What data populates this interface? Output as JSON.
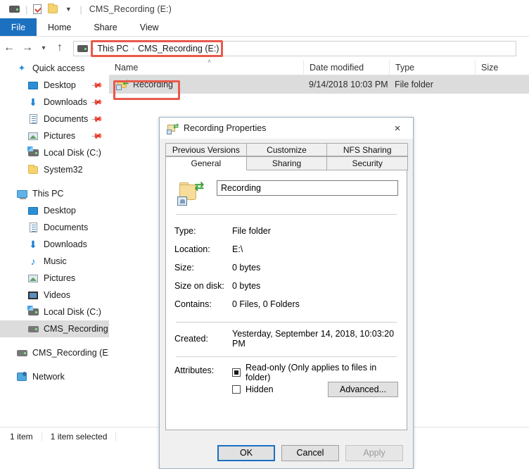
{
  "window": {
    "title": "CMS_Recording (E:)",
    "quick_access_icons": [
      "drive-icon",
      "properties-icon",
      "new-folder-icon",
      "customize-chevron-icon"
    ]
  },
  "ribbon": {
    "tabs": [
      {
        "label": "File",
        "active": true
      },
      {
        "label": "Home",
        "active": false
      },
      {
        "label": "Share",
        "active": false
      },
      {
        "label": "View",
        "active": false
      }
    ]
  },
  "addressbar": {
    "back_icon": "back-arrow-icon",
    "forward_icon": "forward-arrow-icon",
    "recent_icon": "recent-locations-chevron-icon",
    "up_icon": "up-arrow-icon",
    "drive_icon": "drive-icon",
    "crumbs": [
      "This PC",
      "CMS_Recording (E:)"
    ],
    "separator": "›"
  },
  "sidebar": {
    "groups": [
      {
        "header": {
          "label": "Quick access",
          "icon": "star-icon"
        },
        "items": [
          {
            "label": "Desktop",
            "icon": "monitor-icon",
            "pinned": true,
            "selected": false
          },
          {
            "label": "Downloads",
            "icon": "download-icon",
            "pinned": true,
            "selected": false
          },
          {
            "label": "Documents",
            "icon": "document-icon",
            "pinned": true,
            "selected": false
          },
          {
            "label": "Pictures",
            "icon": "picture-icon",
            "pinned": true,
            "selected": false
          },
          {
            "label": "Local Disk (C:)",
            "icon": "system-disk-icon",
            "pinned": false,
            "selected": false
          },
          {
            "label": "System32",
            "icon": "folder-icon",
            "pinned": false,
            "selected": false
          }
        ]
      },
      {
        "header": {
          "label": "This PC",
          "icon": "this-pc-icon"
        },
        "items": [
          {
            "label": "Desktop",
            "icon": "monitor-icon",
            "pinned": false,
            "selected": false
          },
          {
            "label": "Documents",
            "icon": "document-icon",
            "pinned": false,
            "selected": false
          },
          {
            "label": "Downloads",
            "icon": "download-icon",
            "pinned": false,
            "selected": false
          },
          {
            "label": "Music",
            "icon": "music-icon",
            "pinned": false,
            "selected": false
          },
          {
            "label": "Pictures",
            "icon": "picture-icon",
            "pinned": false,
            "selected": false
          },
          {
            "label": "Videos",
            "icon": "video-icon",
            "pinned": false,
            "selected": false
          },
          {
            "label": "Local Disk (C:)",
            "icon": "system-disk-icon",
            "pinned": false,
            "selected": false
          },
          {
            "label": "CMS_Recording (E:)",
            "icon": "drive-icon",
            "pinned": false,
            "selected": true
          }
        ]
      },
      {
        "header": {
          "label": "CMS_Recording (E:)",
          "icon": "drive-icon"
        },
        "items": []
      },
      {
        "header": {
          "label": "Network",
          "icon": "network-icon"
        },
        "items": []
      }
    ]
  },
  "filelist": {
    "columns": [
      "Name",
      "Date modified",
      "Type",
      "Size"
    ],
    "sort_column": "Name",
    "sort_caret": "˄",
    "rows": [
      {
        "name": "Recording",
        "icon": "shared-folder-icon",
        "date_modified": "9/14/2018 10:03 PM",
        "type": "File folder",
        "size": "",
        "selected": true
      }
    ]
  },
  "statusbar": {
    "item_count": "1 item",
    "selection": "1 item selected"
  },
  "dialog": {
    "title": "Recording Properties",
    "title_icon": "shared-folder-icon",
    "close_icon": "×",
    "tabs_row1": [
      {
        "label": "Previous Versions",
        "active": false
      },
      {
        "label": "Customize",
        "active": false
      },
      {
        "label": "NFS Sharing",
        "active": false
      }
    ],
    "tabs_row2": [
      {
        "label": "General",
        "active": true
      },
      {
        "label": "Sharing",
        "active": false
      },
      {
        "label": "Security",
        "active": false
      }
    ],
    "folder_icon": "shared-folder-large-icon",
    "name_value": "Recording",
    "properties": [
      {
        "label": "Type:",
        "value": "File folder"
      },
      {
        "label": "Location:",
        "value": "E:\\"
      },
      {
        "label": "Size:",
        "value": "0 bytes"
      },
      {
        "label": "Size on disk:",
        "value": "0 bytes"
      },
      {
        "label": "Contains:",
        "value": "0 Files, 0 Folders"
      }
    ],
    "created": {
      "label": "Created:",
      "value": "Yesterday, September 14, 2018, 10:03:20 PM"
    },
    "attributes": {
      "label": "Attributes:",
      "readonly": {
        "label": "Read-only (Only applies to files in folder)",
        "state": "indeterminate"
      },
      "hidden": {
        "label": "Hidden",
        "state": "unchecked"
      },
      "advanced_label": "Advanced..."
    },
    "buttons": [
      {
        "label": "OK",
        "style": "primary"
      },
      {
        "label": "Cancel",
        "style": "normal"
      },
      {
        "label": "Apply",
        "style": "disabled"
      }
    ]
  },
  "annotations": {
    "color": "#e8594c",
    "targets": [
      "breadcrumb-path",
      "recording-folder-row"
    ]
  }
}
